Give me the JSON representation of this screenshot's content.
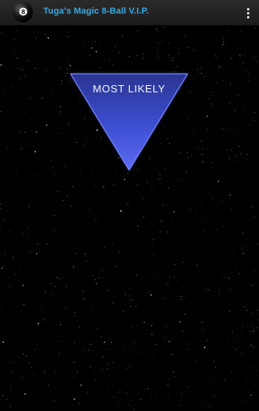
{
  "app_bar": {
    "title": "Tuga's Magic 8-Ball V.I.P.",
    "logo_icon": "magic-8-ball-icon",
    "overflow_icon": "more-vert-icon",
    "title_color": "#37a9e0"
  },
  "answer": {
    "text": "MOST LIKELY",
    "triangle_color": "#3a4fe0"
  }
}
